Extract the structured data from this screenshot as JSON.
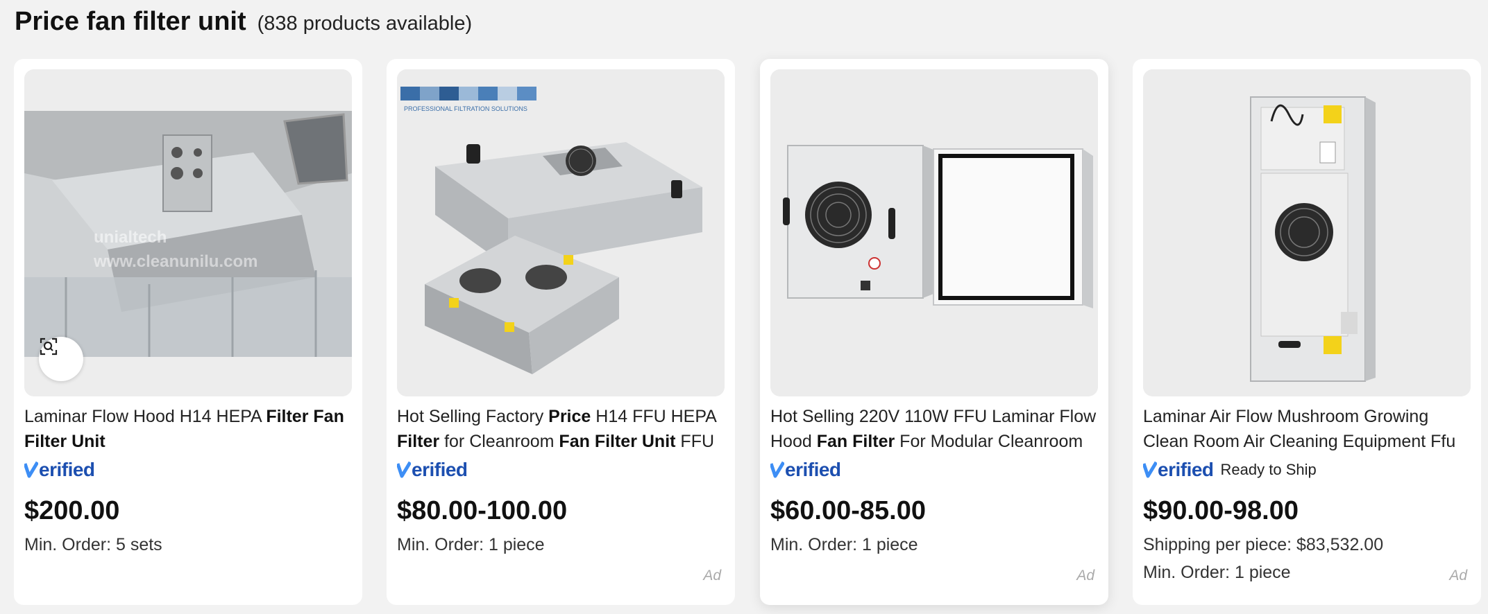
{
  "header": {
    "title": "Price fan filter unit",
    "count": "(838 products available)"
  },
  "products": [
    {
      "title_parts": [
        {
          "text": " Laminar Flow Hood H14 HEPA ",
          "bold": false
        },
        {
          "text": "Filter",
          "bold": true
        },
        {
          "text": " ",
          "bold": false
        },
        {
          "text": "Fan Filter Unit",
          "bold": true
        }
      ],
      "verified": "erified",
      "ready_to_ship": "",
      "price": "$200.00",
      "shipping": "",
      "min_order": "Min. Order: 5 sets",
      "ad": "",
      "watermark": [
        "unialtech",
        "www.cleanunilu.com"
      ],
      "visual_search_icon": "image-search-icon"
    },
    {
      "title_parts": [
        {
          "text": "Hot Selling Factory ",
          "bold": false
        },
        {
          "text": "Price",
          "bold": true
        },
        {
          "text": " H14 FFU HEPA ",
          "bold": false
        },
        {
          "text": "Filter",
          "bold": true
        },
        {
          "text": " for Cleanroom ",
          "bold": false
        },
        {
          "text": "Fan Filter Unit",
          "bold": true
        },
        {
          "text": " FFU",
          "bold": false
        }
      ],
      "verified": "erified",
      "ready_to_ship": "",
      "price": "$80.00-100.00",
      "shipping": "",
      "min_order": "Min. Order: 1 piece",
      "ad": "Ad",
      "watermark": [
        "PROFESSIONAL FILTRATION SOLUTIONS"
      ]
    },
    {
      "title_parts": [
        {
          "text": "Hot Selling 220V 110W FFU Laminar Flow Hood ",
          "bold": false
        },
        {
          "text": "Fan Filter",
          "bold": true
        },
        {
          "text": " For Modular Cleanroom",
          "bold": false
        }
      ],
      "verified": "erified",
      "ready_to_ship": "",
      "price": "$60.00-85.00",
      "shipping": "",
      "min_order": "Min. Order: 1 piece",
      "ad": "Ad"
    },
    {
      "title_parts": [
        {
          "text": "Laminar Air Flow Mushroom Growing Clean Room Air Cleaning Equipment Ffu",
          "bold": false
        }
      ],
      "verified": "erified",
      "ready_to_ship": "Ready to Ship",
      "price": "$90.00-98.00",
      "shipping": "Shipping per piece: $83,532.00",
      "min_order": "Min. Order: 1 piece",
      "ad": "Ad"
    }
  ],
  "colors": {
    "verified_blue": "#1c4fb0",
    "verified_check": "#3d8ef5",
    "background": "#f2f2f2"
  }
}
